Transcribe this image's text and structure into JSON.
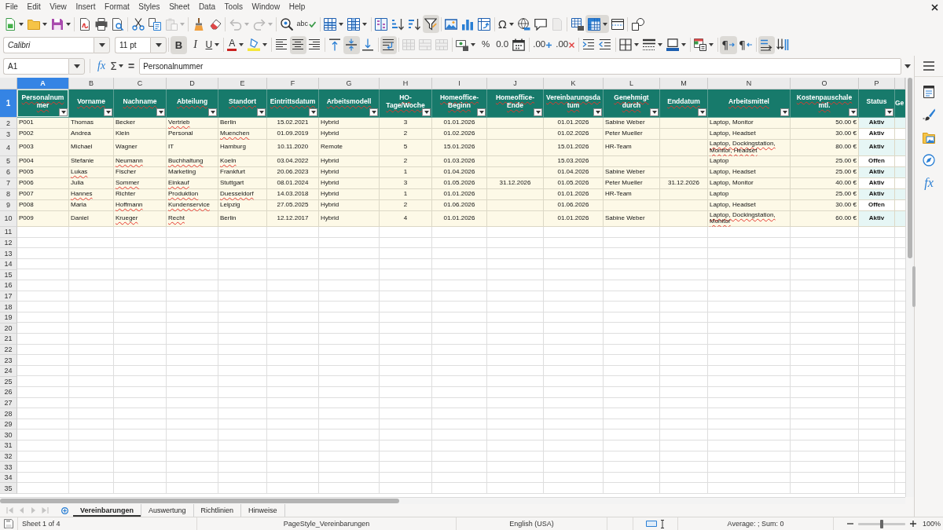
{
  "menu": [
    "File",
    "Edit",
    "View",
    "Insert",
    "Format",
    "Styles",
    "Sheet",
    "Data",
    "Tools",
    "Window",
    "Help"
  ],
  "standard_toolbar": {
    "buttons": [
      {
        "on": false,
        "disabled": false
      },
      {
        "on": false,
        "disabled": false
      },
      {
        "on": false,
        "disabled": false
      },
      {
        "on": false,
        "disabled": false
      },
      {
        "on": false,
        "disabled": false
      },
      {
        "on": false,
        "disabled": false
      },
      {
        "on": false,
        "disabled": false
      },
      {
        "on": false,
        "disabled": false
      },
      {
        "on": false,
        "disabled": true
      },
      {
        "on": false,
        "disabled": false
      },
      {
        "on": false,
        "disabled": false
      },
      {
        "on": false,
        "disabled": true
      },
      {
        "on": false,
        "disabled": true
      },
      {
        "on": false,
        "disabled": false
      },
      {
        "label": "abc",
        "on": false,
        "disabled": false
      },
      {
        "on": false,
        "disabled": false
      },
      {
        "on": false,
        "disabled": false
      },
      {
        "on": false,
        "disabled": false
      },
      {
        "on": false,
        "disabled": false
      },
      {
        "on": false,
        "disabled": false
      },
      {
        "on": true,
        "disabled": false
      },
      {
        "on": false,
        "disabled": false
      },
      {
        "on": false,
        "disabled": false
      },
      {
        "on": false,
        "disabled": false
      },
      {
        "label": "Ω",
        "on": false,
        "disabled": false
      },
      {
        "on": false,
        "disabled": false
      },
      {
        "on": false,
        "disabled": false
      },
      {
        "on": false,
        "disabled": true
      },
      {
        "on": false,
        "disabled": false
      },
      {
        "on": true,
        "disabled": false
      },
      {
        "on": false,
        "disabled": false
      },
      {
        "on": false,
        "disabled": false
      }
    ]
  },
  "formatting_toolbar": {
    "font_name": "Calibri",
    "font_size": "11 pt",
    "buttons": [
      {
        "label": "B",
        "on": true,
        "disabled": false
      },
      {
        "label": "I",
        "on": false,
        "disabled": false
      },
      {
        "label": "U",
        "on": false,
        "disabled": false
      },
      {
        "label": "A",
        "on": false,
        "disabled": false
      },
      {
        "on": false,
        "disabled": false
      },
      {
        "on": false,
        "disabled": false
      },
      {
        "on": true,
        "disabled": false
      },
      {
        "on": false,
        "disabled": false
      },
      {
        "on": false,
        "disabled": false
      },
      {
        "on": true,
        "disabled": false
      },
      {
        "on": false,
        "disabled": false
      },
      {
        "on": true,
        "disabled": false
      },
      {
        "on": false,
        "disabled": true
      },
      {
        "on": false,
        "disabled": true
      },
      {
        "on": false,
        "disabled": true
      },
      {
        "on": false,
        "disabled": false
      },
      {
        "label": "%",
        "on": false,
        "disabled": false
      },
      {
        "label": "0.0",
        "on": false,
        "disabled": false
      },
      {
        "on": false,
        "disabled": false
      },
      {
        "label": ".00",
        "on": false,
        "disabled": false
      },
      {
        "label": ".00",
        "on": false,
        "disabled": false
      },
      {
        "on": false,
        "disabled": false
      },
      {
        "on": false,
        "disabled": false
      },
      {
        "on": false,
        "disabled": false
      },
      {
        "on": false,
        "disabled": false
      },
      {
        "on": false,
        "disabled": false
      },
      {
        "on": false,
        "disabled": false
      },
      {
        "label": "¶",
        "on": true,
        "disabled": false
      },
      {
        "label": "¶",
        "on": false,
        "disabled": false
      },
      {
        "on": true,
        "disabled": false
      },
      {
        "on": false,
        "disabled": false
      }
    ]
  },
  "formula_bar": {
    "name_box": "A1",
    "function_wizard": "fx",
    "sum": "Σ",
    "equals": "=",
    "formula": "Personalnummer"
  },
  "sheet": {
    "columns": [
      {
        "letter": "A",
        "selected": true
      },
      {
        "letter": "B",
        "selected": false
      },
      {
        "letter": "C",
        "selected": false
      },
      {
        "letter": "D",
        "selected": false
      },
      {
        "letter": "E",
        "selected": false
      },
      {
        "letter": "F",
        "selected": false
      },
      {
        "letter": "G",
        "selected": false
      },
      {
        "letter": "H",
        "selected": false
      },
      {
        "letter": "I",
        "selected": false
      },
      {
        "letter": "J",
        "selected": false
      },
      {
        "letter": "K",
        "selected": false
      },
      {
        "letter": "L",
        "selected": false
      },
      {
        "letter": "M",
        "selected": false
      },
      {
        "letter": "N",
        "selected": false
      },
      {
        "letter": "O",
        "selected": false
      },
      {
        "letter": "P",
        "selected": false
      }
    ],
    "header_row": {
      "number": "1",
      "selected": true,
      "cells": [
        {
          "text": "Personalnummer",
          "misspelled": true
        },
        {
          "text": "Vorname",
          "misspelled": true
        },
        {
          "text": "Nachname",
          "misspelled": true
        },
        {
          "text": "Abteilung",
          "misspelled": true
        },
        {
          "text": "Standort",
          "misspelled": true
        },
        {
          "text": "Eintrittsdatum",
          "misspelled": true
        },
        {
          "text": "Arbeitsmodell",
          "misspelled": true
        },
        {
          "text": "HO-Tage/Woche",
          "misspelled": true
        },
        {
          "text": "Homeoffice-Beginn",
          "misspelled": true
        },
        {
          "text": "Homeoffice-Ende",
          "misspelled": true
        },
        {
          "text": "Vereinbarungsdatum",
          "misspelled": true
        },
        {
          "text": "Genehmigt durch",
          "misspelled": true
        },
        {
          "text": "Enddatum",
          "misspelled": true
        },
        {
          "text": "Arbeitsmittel",
          "misspelled": true
        },
        {
          "text": "Kostenpauschale mtl.",
          "misspelled": true
        },
        {
          "text": "Status",
          "misspelled": false
        },
        {
          "text": "Ge",
          "misspelled": false
        }
      ]
    },
    "rows": [
      {
        "number": "2",
        "selected": false,
        "cells": {
          "personalnummer": {
            "text": "P001",
            "misspelled": false
          },
          "vorname": {
            "text": "Thomas",
            "misspelled": false
          },
          "nachname": {
            "text": "Becker",
            "misspelled": false
          },
          "abteilung": {
            "text": "Vertrieb",
            "misspelled": true
          },
          "standort": {
            "text": "Berlin",
            "misspelled": false
          },
          "eintrittsdatum": {
            "text": "15.02.2021",
            "misspelled": false
          },
          "arbeitsmodell": {
            "text": "Hybrid",
            "misspelled": false
          },
          "ho_tage": {
            "text": "3",
            "misspelled": false
          },
          "homeoffice_beginn": {
            "text": "01.01.2026",
            "misspelled": false
          },
          "vereinbarungsdatum": {
            "text": "01.01.2026",
            "misspelled": false
          },
          "genehmigt_durch": {
            "text": "Sabine Weber",
            "misspelled": false
          },
          "arbeitsmittel": {
            "text": "Laptop, Monitor",
            "misspelled": false
          },
          "kostenpauschale": {
            "text": "50.00 €",
            "misspelled": false
          },
          "status": {
            "text": "Aktiv",
            "misspelled": false
          }
        }
      },
      {
        "number": "3",
        "selected": false,
        "cells": {
          "personalnummer": {
            "text": "P002",
            "misspelled": false
          },
          "vorname": {
            "text": "Andrea",
            "misspelled": false
          },
          "nachname": {
            "text": "Klein",
            "misspelled": false
          },
          "abteilung": {
            "text": "Personal",
            "misspelled": false
          },
          "standort": {
            "text": "Muenchen",
            "misspelled": true
          },
          "eintrittsdatum": {
            "text": "01.09.2019",
            "misspelled": false
          },
          "arbeitsmodell": {
            "text": "Hybrid",
            "misspelled": false
          },
          "ho_tage": {
            "text": "2",
            "misspelled": false
          },
          "homeoffice_beginn": {
            "text": "01.02.2026",
            "misspelled": false
          },
          "vereinbarungsdatum": {
            "text": "01.02.2026",
            "misspelled": false
          },
          "genehmigt_durch": {
            "text": "Peter Mueller",
            "misspelled": false
          },
          "arbeitsmittel": {
            "text": "Laptop, Headset",
            "misspelled": false
          },
          "kostenpauschale": {
            "text": "30.00 €",
            "misspelled": false
          },
          "status": {
            "text": "Aktiv",
            "misspelled": false
          }
        }
      },
      {
        "number": "4",
        "selected": false,
        "cells": {
          "personalnummer": {
            "text": "P003",
            "misspelled": false
          },
          "vorname": {
            "text": "Michael",
            "misspelled": false
          },
          "nachname": {
            "text": "Wagner",
            "misspelled": false
          },
          "abteilung": {
            "text": "IT",
            "misspelled": false
          },
          "standort": {
            "text": "Hamburg",
            "misspelled": false
          },
          "eintrittsdatum": {
            "text": "10.11.2020",
            "misspelled": false
          },
          "arbeitsmodell": {
            "text": "Remote",
            "misspelled": false
          },
          "ho_tage": {
            "text": "5",
            "misspelled": false
          },
          "homeoffice_beginn": {
            "text": "15.01.2026",
            "misspelled": false
          },
          "vereinbarungsdatum": {
            "text": "15.01.2026",
            "misspelled": false
          },
          "genehmigt_durch": {
            "text": "HR-Team",
            "misspelled": false
          },
          "arbeitsmittel": {
            "text": "Laptop, Dockingstation, Monitor, Headset",
            "misspelled": true
          },
          "kostenpauschale": {
            "text": "80.00 €",
            "misspelled": false
          },
          "status": {
            "text": "Aktiv",
            "misspelled": false
          }
        }
      },
      {
        "number": "5",
        "selected": false,
        "cells": {
          "personalnummer": {
            "text": "P004",
            "misspelled": false
          },
          "vorname": {
            "text": "Stefanie",
            "misspelled": false
          },
          "nachname": {
            "text": "Neumann",
            "misspelled": true
          },
          "abteilung": {
            "text": "Buchhaltung",
            "misspelled": true
          },
          "standort": {
            "text": "Koeln",
            "misspelled": true
          },
          "eintrittsdatum": {
            "text": "03.04.2022",
            "misspelled": false
          },
          "arbeitsmodell": {
            "text": "Hybrid",
            "misspelled": false
          },
          "ho_tage": {
            "text": "2",
            "misspelled": false
          },
          "homeoffice_beginn": {
            "text": "01.03.2026",
            "misspelled": false
          },
          "vereinbarungsdatum": {
            "text": "15.03.2026",
            "misspelled": false
          },
          "arbeitsmittel": {
            "text": "Laptop",
            "misspelled": false
          },
          "kostenpauschale": {
            "text": "25.00 €",
            "misspelled": false
          },
          "status": {
            "text": "Offen",
            "misspelled": false
          }
        }
      },
      {
        "number": "6",
        "selected": false,
        "cells": {
          "personalnummer": {
            "text": "P005",
            "misspelled": false
          },
          "vorname": {
            "text": "Lukas",
            "misspelled": true
          },
          "nachname": {
            "text": "Fischer",
            "misspelled": false
          },
          "abteilung": {
            "text": "Marketing",
            "misspelled": false
          },
          "standort": {
            "text": "Frankfurt",
            "misspelled": false
          },
          "eintrittsdatum": {
            "text": "20.06.2023",
            "misspelled": false
          },
          "arbeitsmodell": {
            "text": "Hybrid",
            "misspelled": false
          },
          "ho_tage": {
            "text": "1",
            "misspelled": false
          },
          "homeoffice_beginn": {
            "text": "01.04.2026",
            "misspelled": false
          },
          "vereinbarungsdatum": {
            "text": "01.04.2026",
            "misspelled": false
          },
          "genehmigt_durch": {
            "text": "Sabine Weber",
            "misspelled": false
          },
          "arbeitsmittel": {
            "text": "Laptop, Headset",
            "misspelled": false
          },
          "kostenpauschale": {
            "text": "25.00 €",
            "misspelled": false
          },
          "status": {
            "text": "Aktiv",
            "misspelled": false
          }
        }
      },
      {
        "number": "7",
        "selected": false,
        "cells": {
          "personalnummer": {
            "text": "P006",
            "misspelled": false
          },
          "vorname": {
            "text": "Julia",
            "misspelled": false
          },
          "nachname": {
            "text": "Sommer",
            "misspelled": true
          },
          "abteilung": {
            "text": "Einkauf",
            "misspelled": true
          },
          "standort": {
            "text": "Stuttgart",
            "misspelled": false
          },
          "eintrittsdatum": {
            "text": "08.01.2024",
            "misspelled": false
          },
          "arbeitsmodell": {
            "text": "Hybrid",
            "misspelled": false
          },
          "ho_tage": {
            "text": "3",
            "misspelled": false
          },
          "homeoffice_beginn": {
            "text": "01.05.2026",
            "misspelled": false
          },
          "homeoffice_ende": {
            "text": "31.12.2026",
            "misspelled": false
          },
          "vereinbarungsdatum": {
            "text": "01.05.2026",
            "misspelled": false
          },
          "genehmigt_durch": {
            "text": "Peter Mueller",
            "misspelled": false
          },
          "enddatum": {
            "text": "31.12.2026",
            "misspelled": false
          },
          "arbeitsmittel": {
            "text": "Laptop, Monitor",
            "misspelled": false
          },
          "kostenpauschale": {
            "text": "40.00 €",
            "misspelled": false
          },
          "status": {
            "text": "Aktiv",
            "misspelled": false
          }
        }
      },
      {
        "number": "8",
        "selected": false,
        "cells": {
          "personalnummer": {
            "text": "P007",
            "misspelled": false
          },
          "vorname": {
            "text": "Hannes",
            "misspelled": true
          },
          "nachname": {
            "text": "Richter",
            "misspelled": false
          },
          "abteilung": {
            "text": "Produktion",
            "misspelled": true
          },
          "standort": {
            "text": "Duesseldorf",
            "misspelled": true
          },
          "eintrittsdatum": {
            "text": "14.03.2018",
            "misspelled": false
          },
          "arbeitsmodell": {
            "text": "Hybrid",
            "misspelled": false
          },
          "ho_tage": {
            "text": "1",
            "misspelled": false
          },
          "homeoffice_beginn": {
            "text": "01.01.2026",
            "misspelled": false
          },
          "vereinbarungsdatum": {
            "text": "01.01.2026",
            "misspelled": false
          },
          "genehmigt_durch": {
            "text": "HR-Team",
            "misspelled": false
          },
          "arbeitsmittel": {
            "text": "Laptop",
            "misspelled": false
          },
          "kostenpauschale": {
            "text": "25.00 €",
            "misspelled": false
          },
          "status": {
            "text": "Aktiv",
            "misspelled": false
          }
        }
      },
      {
        "number": "9",
        "selected": false,
        "cells": {
          "personalnummer": {
            "text": "P008",
            "misspelled": false
          },
          "vorname": {
            "text": "Maria",
            "misspelled": false
          },
          "nachname": {
            "text": "Hoffmann",
            "misspelled": true
          },
          "abteilung": {
            "text": "Kundenservice",
            "misspelled": true
          },
          "standort": {
            "text": "Leipzig",
            "misspelled": false
          },
          "eintrittsdatum": {
            "text": "27.05.2025",
            "misspelled": false
          },
          "arbeitsmodell": {
            "text": "Hybrid",
            "misspelled": false
          },
          "ho_tage": {
            "text": "2",
            "misspelled": false
          },
          "homeoffice_beginn": {
            "text": "01.06.2026",
            "misspelled": false
          },
          "vereinbarungsdatum": {
            "text": "01.06.2026",
            "misspelled": false
          },
          "arbeitsmittel": {
            "text": "Laptop, Headset",
            "misspelled": false
          },
          "kostenpauschale": {
            "text": "30.00 €",
            "misspelled": false
          },
          "status": {
            "text": "Offen",
            "misspelled": false
          }
        }
      },
      {
        "number": "10",
        "selected": false,
        "cells": {
          "personalnummer": {
            "text": "P009",
            "misspelled": false
          },
          "vorname": {
            "text": "Daniel",
            "misspelled": false
          },
          "nachname": {
            "text": "Krueger",
            "misspelled": true
          },
          "abteilung": {
            "text": "Recht",
            "misspelled": true
          },
          "standort": {
            "text": "Berlin",
            "misspelled": false
          },
          "eintrittsdatum": {
            "text": "12.12.2017",
            "misspelled": false
          },
          "arbeitsmodell": {
            "text": "Hybrid",
            "misspelled": false
          },
          "ho_tage": {
            "text": "4",
            "misspelled": false
          },
          "homeoffice_beginn": {
            "text": "01.01.2026",
            "misspelled": false
          },
          "vereinbarungsdatum": {
            "text": "01.01.2026",
            "misspelled": false
          },
          "genehmigt_durch": {
            "text": "Sabine Weber",
            "misspelled": false
          },
          "arbeitsmittel": {
            "text": "Laptop, Dockingstation, Monitor",
            "misspelled": true
          },
          "kostenpauschale": {
            "text": "60.00 €",
            "misspelled": false
          },
          "status": {
            "text": "Aktiv",
            "misspelled": false
          }
        }
      }
    ],
    "empty_rows": [
      {
        "number": "11",
        "selected": false
      },
      {
        "number": "12",
        "selected": false
      },
      {
        "number": "13",
        "selected": false
      },
      {
        "number": "14",
        "selected": false
      },
      {
        "number": "15",
        "selected": false
      },
      {
        "number": "16",
        "selected": false
      },
      {
        "number": "17",
        "selected": false
      },
      {
        "number": "18",
        "selected": false
      },
      {
        "number": "19",
        "selected": false
      },
      {
        "number": "20",
        "selected": false
      },
      {
        "number": "21",
        "selected": false
      },
      {
        "number": "22",
        "selected": false
      },
      {
        "number": "23",
        "selected": false
      },
      {
        "number": "24",
        "selected": false
      },
      {
        "number": "25",
        "selected": false
      },
      {
        "number": "26",
        "selected": false
      },
      {
        "number": "27",
        "selected": false
      },
      {
        "number": "28",
        "selected": false
      },
      {
        "number": "29",
        "selected": false
      },
      {
        "number": "30",
        "selected": false
      },
      {
        "number": "31",
        "selected": false
      },
      {
        "number": "32",
        "selected": false
      },
      {
        "number": "33",
        "selected": false
      },
      {
        "number": "34",
        "selected": false
      },
      {
        "number": "35",
        "selected": false
      }
    ]
  },
  "sheet_navigation": [
    {
      "disabled": true
    },
    {
      "disabled": true
    },
    {
      "disabled": true
    },
    {
      "disabled": true
    }
  ],
  "sheet_tabs": [
    {
      "label": "Vereinbarungen",
      "selected": true
    },
    {
      "label": "Auswertung",
      "selected": false
    },
    {
      "label": "Richtlinien",
      "selected": false
    },
    {
      "label": "Hinweise",
      "selected": false
    }
  ],
  "sidebar": {
    "functions_label": "fx"
  },
  "status_bar": {
    "sheet_position": "Sheet 1 of 4",
    "page_style": "PageStyle_Vereinbarungen",
    "language": "English (USA)",
    "selection_summary": "Average: ; Sum: 0",
    "zoom_slider": {
      "level": 0.5
    },
    "zoom": "100%"
  }
}
